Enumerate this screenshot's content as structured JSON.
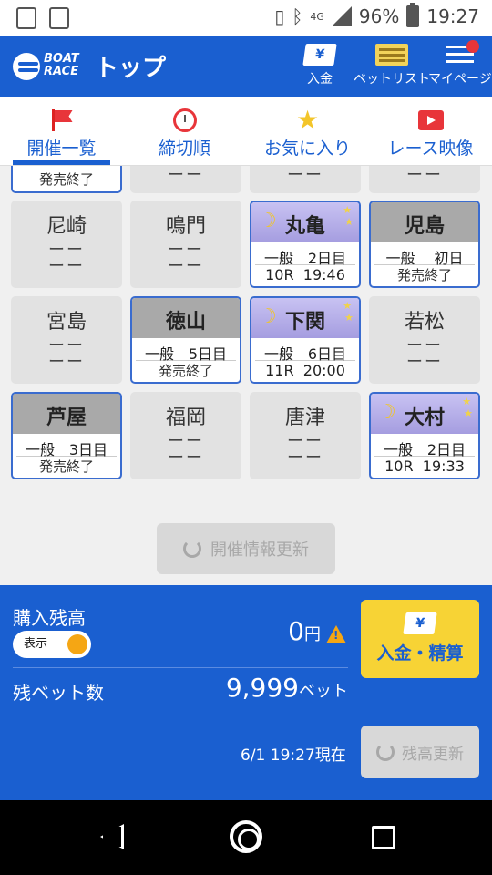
{
  "status_bar": {
    "network": "4G",
    "battery": "96%",
    "time": "19:27"
  },
  "header": {
    "logo_text": "BOAT RACE",
    "title": "トップ",
    "deposit_label": "入金",
    "betlist_label": "ベットリスト",
    "mypage_label": "マイページ"
  },
  "tabs": [
    {
      "label": "開催一覧",
      "icon": "flag-icon",
      "active": true
    },
    {
      "label": "締切順",
      "icon": "alarm-clock-icon"
    },
    {
      "label": "お気に入り",
      "icon": "star-icon"
    },
    {
      "label": "レース映像",
      "icon": "video-icon"
    }
  ],
  "partial_row": [
    {
      "status": "発売終了"
    },
    {
      "dash": "ーー"
    },
    {
      "dash": "ーー"
    },
    {
      "dash": "ーー"
    }
  ],
  "venues": [
    {
      "name": "尼崎",
      "line1": "ーー",
      "line2": "ーー"
    },
    {
      "name": "鳴門",
      "line1": "ーー",
      "line2": "ーー"
    },
    {
      "name": "丸亀",
      "grade": "一般",
      "day": "2日目",
      "race": "10R",
      "time": "19:46"
    },
    {
      "name": "児島",
      "grade": "一般",
      "day": "初日",
      "status": "発売終了"
    },
    {
      "name": "宮島",
      "line1": "ーー",
      "line2": "ーー"
    },
    {
      "name": "徳山",
      "grade": "一般",
      "day": "5日目",
      "status": "発売終了"
    },
    {
      "name": "下関",
      "grade": "一般",
      "day": "6日目",
      "race": "11R",
      "time": "20:00"
    },
    {
      "name": "若松",
      "line1": "ーー",
      "line2": "ーー"
    },
    {
      "name": "芦屋",
      "grade": "一般",
      "day": "3日目",
      "status": "発売終了"
    },
    {
      "name": "福岡",
      "line1": "ーー",
      "line2": "ーー"
    },
    {
      "name": "唐津",
      "line1": "ーー",
      "line2": "ーー"
    },
    {
      "name": "大村",
      "grade": "一般",
      "day": "2日目",
      "race": "10R",
      "time": "19:33"
    }
  ],
  "refresh_button": "開催情報更新",
  "balance": {
    "label": "購入残高",
    "toggle_label": "表示",
    "amount": "0",
    "unit": "円",
    "deposit_button": "入金・精算",
    "bets_label": "残ベット数",
    "bets_value": "9,999",
    "bets_unit": "ベット",
    "timestamp": "6/1 19:27現在",
    "update_button": "残高更新"
  },
  "colors": {
    "brand_blue": "#1a5fd0",
    "accent_yellow": "#f7d335",
    "night_purple": "#a59de0"
  }
}
